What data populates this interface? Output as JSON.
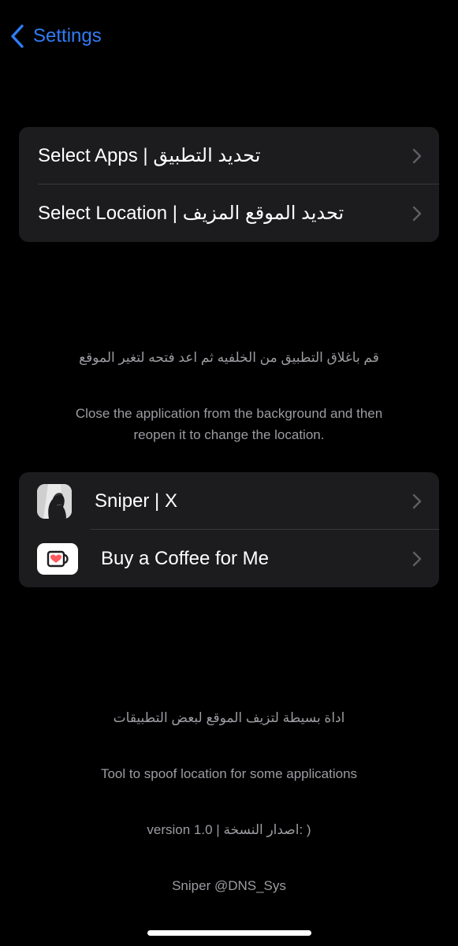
{
  "nav": {
    "back_label": "Settings",
    "accent_color": "#2f7cf6"
  },
  "location_group": {
    "items": [
      {
        "label": "Select Apps | تحديد التطبيق",
        "icon": "chevron-right-icon"
      },
      {
        "label": "Select Location | تحديد الموقع المزيف",
        "icon": "chevron-right-icon"
      }
    ]
  },
  "instructions": {
    "arabic": "قم باغلاق التطبيق من الخلفيه ثم اعد فتحه لتغير الموقع",
    "english_line1": "Close the application from the background and then",
    "english_line2": "reopen it to change the location."
  },
  "links_group": {
    "items": [
      {
        "label": "Sniper | X",
        "icon": "profile-photo-icon"
      },
      {
        "label": "Buy a Coffee for Me",
        "icon": "coffee-cup-icon"
      }
    ]
  },
  "footer": {
    "arabic_description": "اداة بسيطة لتزيف الموقع لبعض التطبيقات",
    "english_description": "Tool to spoof location for some applications",
    "version": "version 1.0 | اصدار النسخة: )",
    "author": "Sniper @DNS_Sys"
  }
}
